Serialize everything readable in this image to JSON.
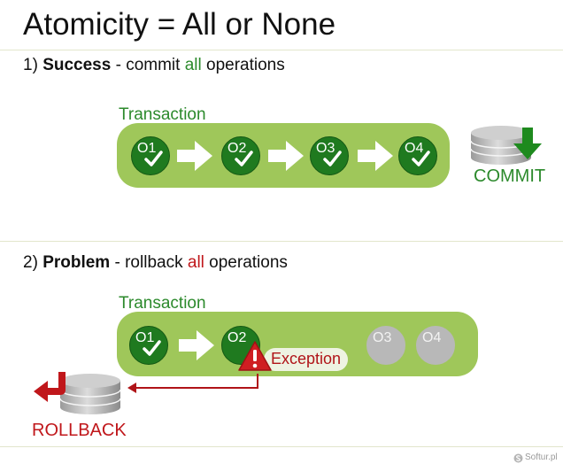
{
  "title": "Atomicity = All or None",
  "section1": {
    "number": "1)",
    "keyword": "Success",
    "dash": "-",
    "verb": "commit",
    "highlight": "all",
    "tail": "operations",
    "transaction_label": "Transaction",
    "operations": [
      "O1",
      "O2",
      "O3",
      "O4"
    ],
    "result_label": "COMMIT"
  },
  "section2": {
    "number": "2)",
    "keyword": "Problem",
    "dash": "-",
    "verb": "rollback",
    "highlight": "all",
    "tail": "operations",
    "transaction_label": "Transaction",
    "operations": [
      "O1",
      "O2",
      "O3",
      "O4"
    ],
    "exception_label": "Exception",
    "result_label": "ROLLBACK"
  },
  "footer": "Softur.pl",
  "colors": {
    "green": "#2c8a2c",
    "dark_green": "#1f7a1f",
    "bar_green": "#9fc75a",
    "red": "#c0171b",
    "gray": "#b8b8b8"
  }
}
